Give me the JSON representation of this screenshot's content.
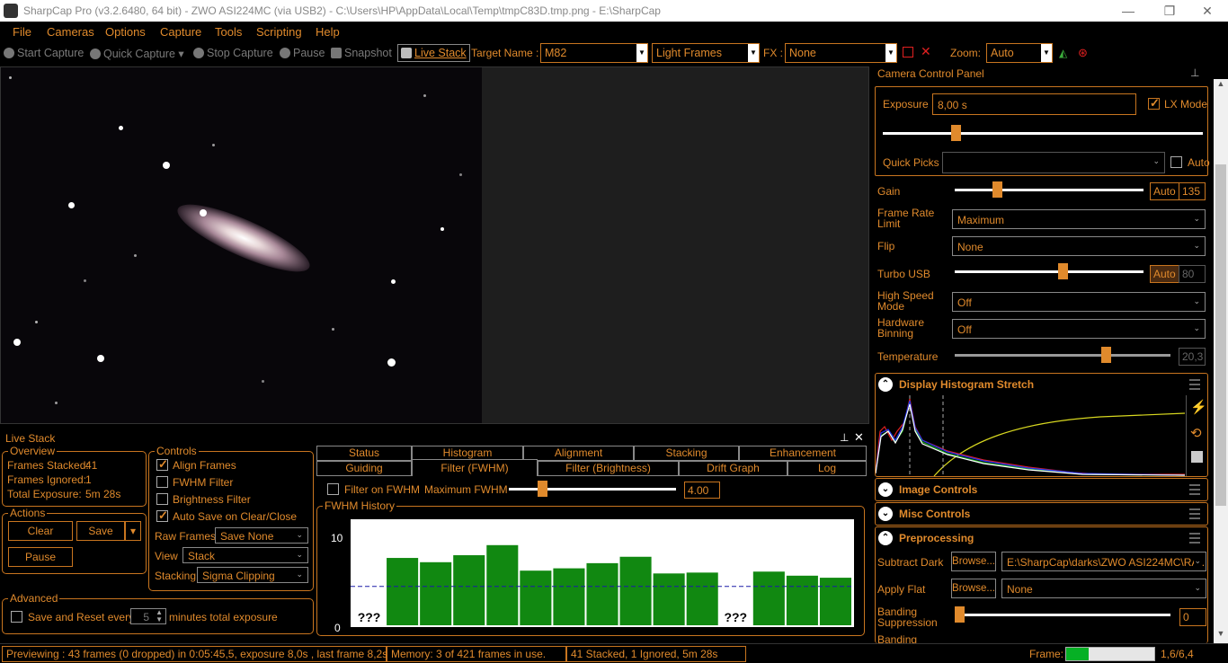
{
  "window": {
    "title": "SharpCap Pro (v3.2.6480, 64 bit) - ZWO ASI224MC (via USB2) - C:\\Users\\HP\\AppData\\Local\\Temp\\tmpC83D.tmp.png - E:\\SharpCap",
    "minimize": "—",
    "restore": "❐",
    "close": "✕"
  },
  "menu": [
    "File",
    "Cameras",
    "Options",
    "Capture",
    "Tools",
    "Scripting",
    "Help"
  ],
  "toolbar": {
    "start_capture": "Start Capture",
    "quick_capture": "Quick Capture",
    "stop_capture": "Stop Capture",
    "pause": "Pause",
    "snapshot": "Snapshot",
    "live_stack": "Live Stack",
    "target_name_label": "Target Name :",
    "target_name_value": "M82",
    "frame_type": "Light Frames",
    "fx_label": "FX :",
    "fx_value": "None",
    "zoom_label": "Zoom:",
    "zoom_value": "Auto"
  },
  "live_stack": {
    "title": "Live Stack",
    "overview": {
      "title": "Overview",
      "frames_stacked_label": "Frames Stacked:",
      "frames_stacked": "41",
      "frames_ignored_label": "Frames Ignored:",
      "frames_ignored": "1",
      "total_exposure_label": "Total Exposure:",
      "total_exposure": "5m 28s"
    },
    "actions": {
      "title": "Actions",
      "clear": "Clear",
      "save": "Save",
      "pause": "Pause"
    },
    "advanced": {
      "title": "Advanced",
      "save_reset_label": "Save and Reset every",
      "save_reset_value": "5",
      "minutes_label": "minutes total exposure"
    },
    "controls": {
      "title": "Controls",
      "align_frames": "Align Frames",
      "fwhm_filter": "FWHM Filter",
      "brightness_filter": "Brightness Filter",
      "auto_save": "Auto Save on Clear/Close",
      "raw_frames_label": "Raw Frames",
      "raw_frames_value": "Save None",
      "view_label": "View",
      "view_value": "Stack",
      "stacking_label": "Stacking",
      "stacking_value": "Sigma Clipping"
    },
    "tabs_row1": [
      "Status",
      "Histogram",
      "Alignment",
      "Stacking",
      "Enhancement"
    ],
    "tabs_row2": [
      "Guiding",
      "Filter (FWHM)",
      "Filter (Brightness)",
      "Drift Graph",
      "Log"
    ],
    "filter_on_fwhm": "Filter on FWHM",
    "max_fwhm_label": "Maximum FWHM",
    "max_fwhm_value": "4.00",
    "fwhm_history_title": "FWHM History"
  },
  "chart_data": {
    "type": "bar",
    "title": "FWHM History",
    "ylim": [
      0,
      10
    ],
    "yticks": [
      "10",
      "0"
    ],
    "threshold": 4.0,
    "values": [
      null,
      6.94,
      6.5,
      7.22,
      8.26,
      5.63,
      5.87,
      6.4,
      7.06,
      5.34,
      5.43,
      null,
      5.53,
      5.11,
      4.9
    ],
    "labels": [
      "???",
      "6,94",
      "6,50",
      "7,22",
      "8,26",
      "5,63",
      "5,87",
      "6,40",
      "7,06",
      "5,34",
      "5,43",
      "???",
      "5,53",
      "5,11",
      "4,90"
    ],
    "bar_color": "#118811",
    "threshold_color": "#1a1aa8"
  },
  "camera_panel": {
    "title": "Camera Control Panel",
    "exposure_label": "Exposure",
    "exposure_value": "8,00 s",
    "lx_mode": "LX Mode",
    "quick_picks_label": "Quick Picks",
    "auto_label": "Auto",
    "gain_label": "Gain",
    "gain_auto": "Auto",
    "gain_value": "135",
    "frame_rate_label": "Frame Rate Limit",
    "frame_rate_value": "Maximum",
    "flip_label": "Flip",
    "flip_value": "None",
    "turbo_label": "Turbo USB",
    "turbo_auto": "Auto",
    "turbo_value": "80",
    "high_speed_label": "High Speed Mode",
    "high_speed_value": "Off",
    "hw_binning_label": "Hardware Binning",
    "hw_binning_value": "Off",
    "temperature_label": "Temperature",
    "temperature_value": "20,3",
    "exposure_level": 0.22,
    "gain_level": 0.21,
    "turbo_level": 0.58,
    "temperature_level": 0.71
  },
  "sections": {
    "histogram": "Display Histogram Stretch",
    "image_controls": "Image Controls",
    "misc_controls": "Misc Controls",
    "preprocessing": "Preprocessing"
  },
  "preprocessing": {
    "subtract_dark_label": "Subtract Dark",
    "browse": "Browse...",
    "dark_path": "E:\\SharpCap\\darks\\ZWO ASI224MC\\RA...",
    "apply_flat_label": "Apply Flat",
    "flat_value": "None",
    "banding_label": "Banding Suppression",
    "banding_value": "0",
    "banding2_label": "Banding"
  },
  "status": {
    "previewing": "Previewing : 43 frames (0 dropped) in 0:05:45,5, exposure 8,0s , last frame 8,2s",
    "memory": "Memory: 3 of 421 frames in use.",
    "stacked": "41 Stacked, 1 Ignored, 5m 28s",
    "frame_label": "Frame:",
    "frame_value": "1,6/6,4",
    "frame_progress": 0.25
  },
  "colors": {
    "accent": "#e08a2c",
    "background": "#000000",
    "bar_green": "#118811"
  }
}
